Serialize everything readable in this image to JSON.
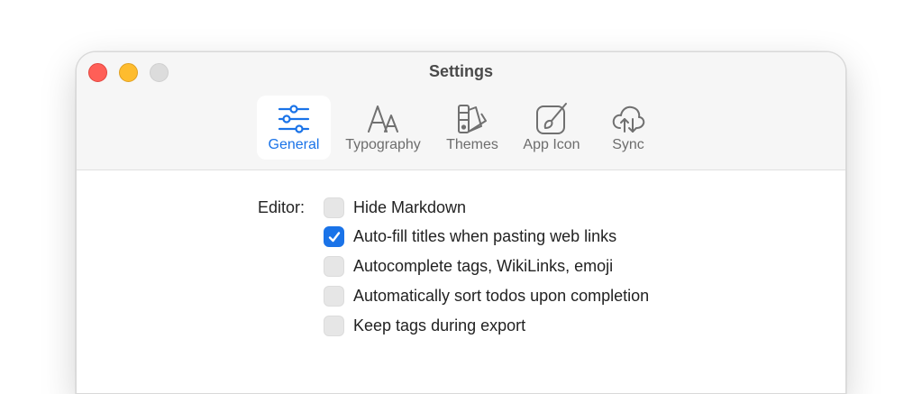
{
  "window": {
    "title": "Settings"
  },
  "tabs": [
    {
      "label": "General",
      "icon": "sliders-icon",
      "active": true
    },
    {
      "label": "Typography",
      "icon": "typography-icon",
      "active": false
    },
    {
      "label": "Themes",
      "icon": "swatches-icon",
      "active": false
    },
    {
      "label": "App Icon",
      "icon": "paintbrush-icon",
      "active": false
    },
    {
      "label": "Sync",
      "icon": "cloud-sync-icon",
      "active": false
    }
  ],
  "editor": {
    "label": "Editor:",
    "options": [
      {
        "label": "Hide Markdown",
        "checked": false
      },
      {
        "label": "Auto-fill titles when pasting web links",
        "checked": true
      },
      {
        "label": "Autocomplete tags, WikiLinks, emoji",
        "checked": false
      },
      {
        "label": "Automatically sort todos upon completion",
        "checked": false
      },
      {
        "label": "Keep tags during export",
        "checked": false
      }
    ]
  },
  "colors": {
    "accent": "#1a73e8",
    "close": "#ff5f57",
    "minimize": "#febc2e",
    "maximize": "#dcdcdc"
  }
}
